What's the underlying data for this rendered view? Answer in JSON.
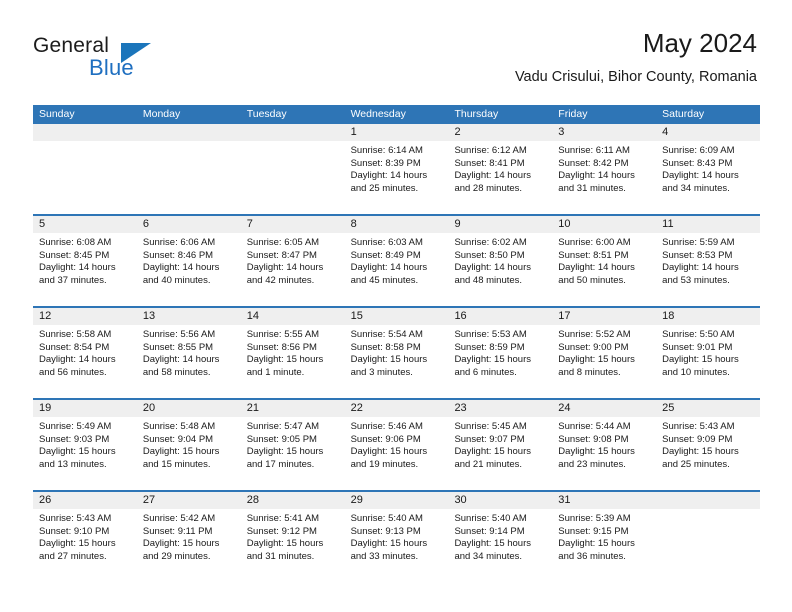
{
  "brand": {
    "name_part1": "General",
    "name_part2": "Blue"
  },
  "header": {
    "title": "May 2024",
    "subtitle": "Vadu Crisului, Bihor County, Romania"
  },
  "colors": {
    "header_blue": "#2e75b6",
    "brand_blue": "#1b75bb",
    "day_band_gray": "#efefef"
  },
  "weekdays": [
    "Sunday",
    "Monday",
    "Tuesday",
    "Wednesday",
    "Thursday",
    "Friday",
    "Saturday"
  ],
  "weeks": [
    [
      {
        "day": "",
        "sunrise": "",
        "sunset": "",
        "daylight_line1": "",
        "daylight_line2": ""
      },
      {
        "day": "",
        "sunrise": "",
        "sunset": "",
        "daylight_line1": "",
        "daylight_line2": ""
      },
      {
        "day": "",
        "sunrise": "",
        "sunset": "",
        "daylight_line1": "",
        "daylight_line2": ""
      },
      {
        "day": "1",
        "sunrise": "Sunrise: 6:14 AM",
        "sunset": "Sunset: 8:39 PM",
        "daylight_line1": "Daylight: 14 hours",
        "daylight_line2": "and 25 minutes."
      },
      {
        "day": "2",
        "sunrise": "Sunrise: 6:12 AM",
        "sunset": "Sunset: 8:41 PM",
        "daylight_line1": "Daylight: 14 hours",
        "daylight_line2": "and 28 minutes."
      },
      {
        "day": "3",
        "sunrise": "Sunrise: 6:11 AM",
        "sunset": "Sunset: 8:42 PM",
        "daylight_line1": "Daylight: 14 hours",
        "daylight_line2": "and 31 minutes."
      },
      {
        "day": "4",
        "sunrise": "Sunrise: 6:09 AM",
        "sunset": "Sunset: 8:43 PM",
        "daylight_line1": "Daylight: 14 hours",
        "daylight_line2": "and 34 minutes."
      }
    ],
    [
      {
        "day": "5",
        "sunrise": "Sunrise: 6:08 AM",
        "sunset": "Sunset: 8:45 PM",
        "daylight_line1": "Daylight: 14 hours",
        "daylight_line2": "and 37 minutes."
      },
      {
        "day": "6",
        "sunrise": "Sunrise: 6:06 AM",
        "sunset": "Sunset: 8:46 PM",
        "daylight_line1": "Daylight: 14 hours",
        "daylight_line2": "and 40 minutes."
      },
      {
        "day": "7",
        "sunrise": "Sunrise: 6:05 AM",
        "sunset": "Sunset: 8:47 PM",
        "daylight_line1": "Daylight: 14 hours",
        "daylight_line2": "and 42 minutes."
      },
      {
        "day": "8",
        "sunrise": "Sunrise: 6:03 AM",
        "sunset": "Sunset: 8:49 PM",
        "daylight_line1": "Daylight: 14 hours",
        "daylight_line2": "and 45 minutes."
      },
      {
        "day": "9",
        "sunrise": "Sunrise: 6:02 AM",
        "sunset": "Sunset: 8:50 PM",
        "daylight_line1": "Daylight: 14 hours",
        "daylight_line2": "and 48 minutes."
      },
      {
        "day": "10",
        "sunrise": "Sunrise: 6:00 AM",
        "sunset": "Sunset: 8:51 PM",
        "daylight_line1": "Daylight: 14 hours",
        "daylight_line2": "and 50 minutes."
      },
      {
        "day": "11",
        "sunrise": "Sunrise: 5:59 AM",
        "sunset": "Sunset: 8:53 PM",
        "daylight_line1": "Daylight: 14 hours",
        "daylight_line2": "and 53 minutes."
      }
    ],
    [
      {
        "day": "12",
        "sunrise": "Sunrise: 5:58 AM",
        "sunset": "Sunset: 8:54 PM",
        "daylight_line1": "Daylight: 14 hours",
        "daylight_line2": "and 56 minutes."
      },
      {
        "day": "13",
        "sunrise": "Sunrise: 5:56 AM",
        "sunset": "Sunset: 8:55 PM",
        "daylight_line1": "Daylight: 14 hours",
        "daylight_line2": "and 58 minutes."
      },
      {
        "day": "14",
        "sunrise": "Sunrise: 5:55 AM",
        "sunset": "Sunset: 8:56 PM",
        "daylight_line1": "Daylight: 15 hours",
        "daylight_line2": "and 1 minute."
      },
      {
        "day": "15",
        "sunrise": "Sunrise: 5:54 AM",
        "sunset": "Sunset: 8:58 PM",
        "daylight_line1": "Daylight: 15 hours",
        "daylight_line2": "and 3 minutes."
      },
      {
        "day": "16",
        "sunrise": "Sunrise: 5:53 AM",
        "sunset": "Sunset: 8:59 PM",
        "daylight_line1": "Daylight: 15 hours",
        "daylight_line2": "and 6 minutes."
      },
      {
        "day": "17",
        "sunrise": "Sunrise: 5:52 AM",
        "sunset": "Sunset: 9:00 PM",
        "daylight_line1": "Daylight: 15 hours",
        "daylight_line2": "and 8 minutes."
      },
      {
        "day": "18",
        "sunrise": "Sunrise: 5:50 AM",
        "sunset": "Sunset: 9:01 PM",
        "daylight_line1": "Daylight: 15 hours",
        "daylight_line2": "and 10 minutes."
      }
    ],
    [
      {
        "day": "19",
        "sunrise": "Sunrise: 5:49 AM",
        "sunset": "Sunset: 9:03 PM",
        "daylight_line1": "Daylight: 15 hours",
        "daylight_line2": "and 13 minutes."
      },
      {
        "day": "20",
        "sunrise": "Sunrise: 5:48 AM",
        "sunset": "Sunset: 9:04 PM",
        "daylight_line1": "Daylight: 15 hours",
        "daylight_line2": "and 15 minutes."
      },
      {
        "day": "21",
        "sunrise": "Sunrise: 5:47 AM",
        "sunset": "Sunset: 9:05 PM",
        "daylight_line1": "Daylight: 15 hours",
        "daylight_line2": "and 17 minutes."
      },
      {
        "day": "22",
        "sunrise": "Sunrise: 5:46 AM",
        "sunset": "Sunset: 9:06 PM",
        "daylight_line1": "Daylight: 15 hours",
        "daylight_line2": "and 19 minutes."
      },
      {
        "day": "23",
        "sunrise": "Sunrise: 5:45 AM",
        "sunset": "Sunset: 9:07 PM",
        "daylight_line1": "Daylight: 15 hours",
        "daylight_line2": "and 21 minutes."
      },
      {
        "day": "24",
        "sunrise": "Sunrise: 5:44 AM",
        "sunset": "Sunset: 9:08 PM",
        "daylight_line1": "Daylight: 15 hours",
        "daylight_line2": "and 23 minutes."
      },
      {
        "day": "25",
        "sunrise": "Sunrise: 5:43 AM",
        "sunset": "Sunset: 9:09 PM",
        "daylight_line1": "Daylight: 15 hours",
        "daylight_line2": "and 25 minutes."
      }
    ],
    [
      {
        "day": "26",
        "sunrise": "Sunrise: 5:43 AM",
        "sunset": "Sunset: 9:10 PM",
        "daylight_line1": "Daylight: 15 hours",
        "daylight_line2": "and 27 minutes."
      },
      {
        "day": "27",
        "sunrise": "Sunrise: 5:42 AM",
        "sunset": "Sunset: 9:11 PM",
        "daylight_line1": "Daylight: 15 hours",
        "daylight_line2": "and 29 minutes."
      },
      {
        "day": "28",
        "sunrise": "Sunrise: 5:41 AM",
        "sunset": "Sunset: 9:12 PM",
        "daylight_line1": "Daylight: 15 hours",
        "daylight_line2": "and 31 minutes."
      },
      {
        "day": "29",
        "sunrise": "Sunrise: 5:40 AM",
        "sunset": "Sunset: 9:13 PM",
        "daylight_line1": "Daylight: 15 hours",
        "daylight_line2": "and 33 minutes."
      },
      {
        "day": "30",
        "sunrise": "Sunrise: 5:40 AM",
        "sunset": "Sunset: 9:14 PM",
        "daylight_line1": "Daylight: 15 hours",
        "daylight_line2": "and 34 minutes."
      },
      {
        "day": "31",
        "sunrise": "Sunrise: 5:39 AM",
        "sunset": "Sunset: 9:15 PM",
        "daylight_line1": "Daylight: 15 hours",
        "daylight_line2": "and 36 minutes."
      },
      {
        "day": "",
        "sunrise": "",
        "sunset": "",
        "daylight_line1": "",
        "daylight_line2": ""
      }
    ]
  ]
}
